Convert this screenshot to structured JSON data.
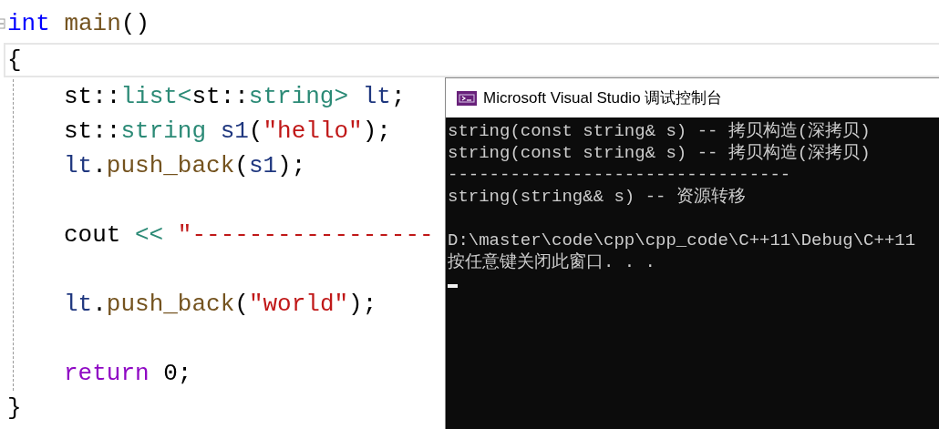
{
  "editor": {
    "lines": [
      {
        "tokens": [
          {
            "text": "int",
            "kind": "keyword"
          },
          {
            "text": " main",
            "kind": "function"
          },
          {
            "text": "()",
            "kind": "plain"
          }
        ],
        "current": false
      },
      {
        "tokens": [
          {
            "text": "{",
            "kind": "plain"
          }
        ],
        "current": true,
        "children": [
          {
            "lines": [
              {
                "tokens": [
                  {
                    "text": "st::",
                    "kind": "plain"
                  },
                  {
                    "text": "list<",
                    "kind": "type"
                  },
                  {
                    "text": "st::",
                    "kind": "plain"
                  },
                  {
                    "text": "string> ",
                    "kind": "type"
                  },
                  {
                    "text": "lt",
                    "kind": "variable"
                  },
                  {
                    "text": ";",
                    "kind": "plain"
                  }
                ]
              },
              {
                "tokens": [
                  {
                    "text": "st::",
                    "kind": "plain"
                  },
                  {
                    "text": "string ",
                    "kind": "type"
                  },
                  {
                    "text": "s1",
                    "kind": "variable"
                  },
                  {
                    "text": "(",
                    "kind": "plain"
                  },
                  {
                    "text": "\"hello\"",
                    "kind": "string"
                  },
                  {
                    "text": ");",
                    "kind": "plain"
                  }
                ]
              },
              {
                "tokens": [
                  {
                    "text": "lt",
                    "kind": "variable"
                  },
                  {
                    "text": ".",
                    "kind": "plain"
                  },
                  {
                    "text": "push_back",
                    "kind": "function"
                  },
                  {
                    "text": "(",
                    "kind": "plain"
                  },
                  {
                    "text": "s1",
                    "kind": "variable"
                  },
                  {
                    "text": ");",
                    "kind": "plain"
                  }
                ]
              }
            ]
          },
          {
            "lines": [
              {
                "tokens": [
                  {
                    "text": "cout ",
                    "kind": "plain"
                  },
                  {
                    "text": "<< ",
                    "kind": "operator"
                  },
                  {
                    "text": "\"-----------------",
                    "kind": "string"
                  }
                ]
              }
            ]
          },
          {
            "lines": [
              {
                "tokens": [
                  {
                    "text": "lt",
                    "kind": "variable"
                  },
                  {
                    "text": ".",
                    "kind": "plain"
                  },
                  {
                    "text": "push_back",
                    "kind": "function"
                  },
                  {
                    "text": "(",
                    "kind": "plain"
                  },
                  {
                    "text": "\"world\"",
                    "kind": "string"
                  },
                  {
                    "text": ");",
                    "kind": "plain"
                  }
                ]
              }
            ]
          },
          {
            "lines": [
              {
                "tokens": [
                  {
                    "text": "return",
                    "kind": "control"
                  },
                  {
                    "text": " 0;",
                    "kind": "plain"
                  }
                ]
              }
            ]
          }
        ]
      },
      {
        "tokens": [
          {
            "text": "}",
            "kind": "plain"
          }
        ],
        "current": false
      }
    ]
  },
  "console": {
    "title": "Microsoft Visual Studio 调试控制台",
    "paragraphs": [
      {
        "lines": [
          "string(const string& s) -- 拷贝构造(深拷贝)",
          "string(const string& s) -- 拷贝构造(深拷贝)",
          "---------------------------------",
          "string(string&& s) -- 资源转移"
        ]
      },
      {
        "lines": [
          "D:\\master\\code\\cpp\\cpp_code\\C++11\\Debug\\C++11",
          "按任意键关闭此窗口. . ."
        ]
      }
    ],
    "cursor_visible": true
  }
}
